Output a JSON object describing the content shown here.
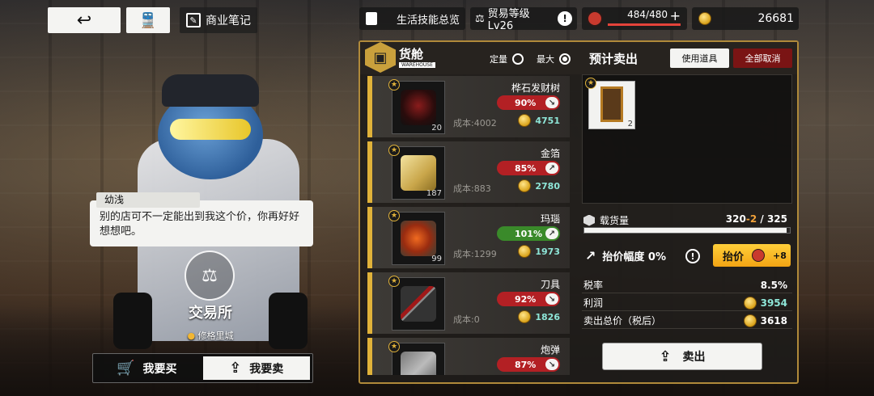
{
  "top_left": {
    "back_icon": "back-arrow-icon",
    "train_icon": "train-icon",
    "notes_label": "商业笔记"
  },
  "top_right": {
    "skills_label": "生活技能总览",
    "trade_level": "贸易等级Lv26",
    "stamina": "484/480",
    "gold": "26681"
  },
  "npc": {
    "name": "幼浅",
    "dialogue": "别的店可不一定能出到我这个价，你再好好想想吧。"
  },
  "station": {
    "title": "交易所",
    "location": "修格里城"
  },
  "tabs": {
    "buy": "我要买",
    "sell": "我要卖"
  },
  "warehouse": {
    "title": "货舱",
    "subtitle": "WAREHOUSE",
    "mode_fixed": "定量",
    "mode_max": "最大",
    "selected_mode": "max"
  },
  "items": [
    {
      "name": "桦石发财树",
      "qty": "20",
      "pct": "90%",
      "trend": "down",
      "cost": "成本:4002",
      "price": "4751",
      "color": "#b32024"
    },
    {
      "name": "金箔",
      "qty": "187",
      "pct": "85%",
      "trend": "up",
      "cost": "成本:883",
      "price": "2780",
      "color": "#b32024"
    },
    {
      "name": "玛瑙",
      "qty": "99",
      "pct": "101%",
      "trend": "up",
      "cost": "成本:1299",
      "price": "1973",
      "color": "#3a8a2a"
    },
    {
      "name": "刀具",
      "qty": "",
      "pct": "92%",
      "trend": "down",
      "cost": "成本:0",
      "price": "1826",
      "color": "#b32024"
    },
    {
      "name": "炮弹",
      "qty": "",
      "pct": "87%",
      "trend": "down",
      "cost": "",
      "price": "",
      "color": "#b32024"
    }
  ],
  "sale": {
    "title": "预计卖出",
    "use_item_btn": "使用道具",
    "cancel_all_btn": "全部取消",
    "slot_qty": "2",
    "capacity_label": "载货量",
    "capacity_used": "320",
    "capacity_delta": "-2",
    "capacity_total": "/ 325",
    "capacity_fill": 0.985,
    "haggle_label": "抬价幅度 0%",
    "haggle_btn": "抬价",
    "haggle_cost": "+8",
    "tax_label": "税率",
    "tax_value": "8.5%",
    "profit_label": "利润",
    "profit_value": "3954",
    "total_label": "卖出总价（税后）",
    "total_value": "3618",
    "sell_btn": "卖出"
  }
}
